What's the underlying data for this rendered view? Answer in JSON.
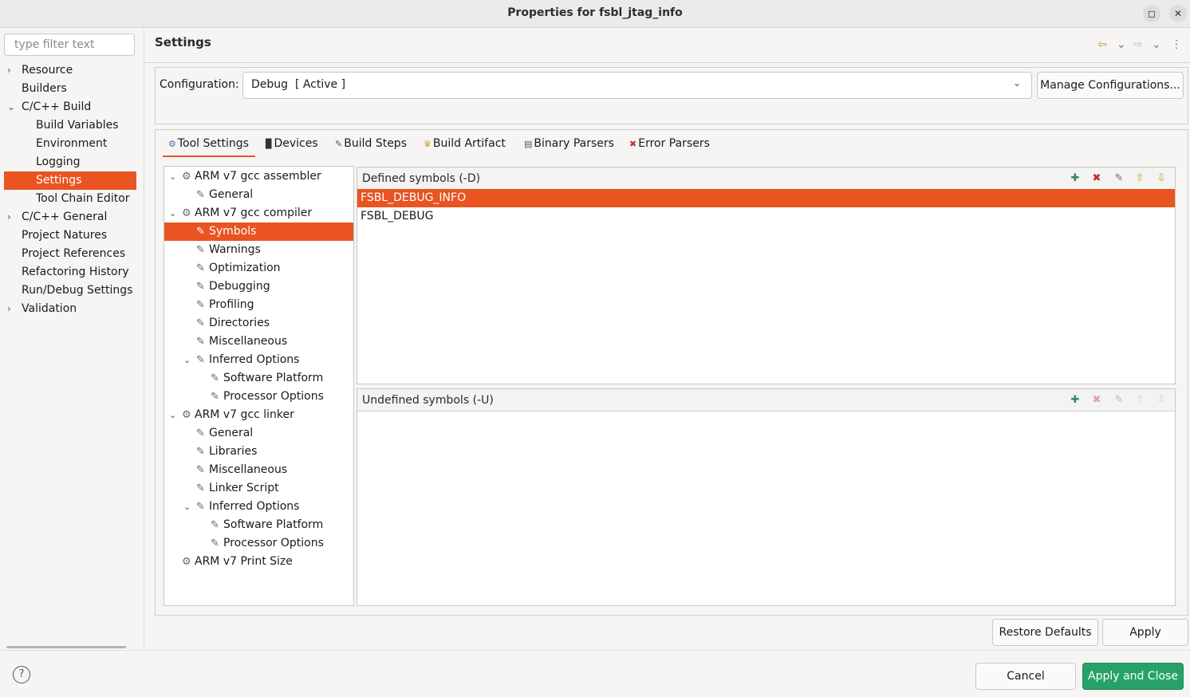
{
  "window": {
    "title": "Properties for fsbl_jtag_info",
    "maximize_glyph": "◻",
    "close_glyph": "✕"
  },
  "filter": {
    "placeholder": "type filter text"
  },
  "nav": {
    "items": [
      {
        "label": "Resource",
        "expander": "›"
      },
      {
        "label": "Builders",
        "expander": ""
      },
      {
        "label": "C/C++ Build",
        "expander": "⌄"
      },
      {
        "label": "Build Variables",
        "expander": ""
      },
      {
        "label": "Environment",
        "expander": ""
      },
      {
        "label": "Logging",
        "expander": ""
      },
      {
        "label": "Settings",
        "expander": ""
      },
      {
        "label": "Tool Chain Editor",
        "expander": ""
      },
      {
        "label": "C/C++ General",
        "expander": "›"
      },
      {
        "label": "Project Natures",
        "expander": ""
      },
      {
        "label": "Project References",
        "expander": ""
      },
      {
        "label": "Refactoring History",
        "expander": ""
      },
      {
        "label": "Run/Debug Settings",
        "expander": ""
      },
      {
        "label": "Validation",
        "expander": "›"
      }
    ],
    "selected": "Settings"
  },
  "header": {
    "title": "Settings",
    "back_icon": "⇦",
    "back_menu_icon": "⌄",
    "forward_icon": "⇨",
    "forward_menu_icon": "⌄",
    "more_icon": "⋮"
  },
  "configuration": {
    "label": "Configuration:",
    "value": "Debug  [ Active ]",
    "chevron": "⌄",
    "manage_label": "Manage Configurations..."
  },
  "tabs": [
    {
      "label": "Tool Settings",
      "icon": "⚙",
      "icon_color": "#4a6fa5",
      "active": true
    },
    {
      "label": "Devices",
      "icon": "▉",
      "icon_color": "#333333"
    },
    {
      "label": "Build Steps",
      "icon": "✎",
      "icon_color": "#555555"
    },
    {
      "label": "Build Artifact",
      "icon": "♛",
      "icon_color": "#d4a017"
    },
    {
      "label": "Binary Parsers",
      "icon": "▤",
      "icon_color": "#555555"
    },
    {
      "label": "Error Parsers",
      "icon": "✖",
      "icon_color": "#d0312d"
    }
  ],
  "tree": {
    "rows": [
      {
        "label": "ARM v7 gcc assembler",
        "expander": "⌄",
        "icon": "⚙"
      },
      {
        "label": "General",
        "expander": "",
        "icon": "✎"
      },
      {
        "label": "ARM v7 gcc compiler",
        "expander": "⌄",
        "icon": "⚙"
      },
      {
        "label": "Symbols",
        "expander": "",
        "icon": "✎"
      },
      {
        "label": "Warnings",
        "expander": "",
        "icon": "✎"
      },
      {
        "label": "Optimization",
        "expander": "",
        "icon": "✎"
      },
      {
        "label": "Debugging",
        "expander": "",
        "icon": "✎"
      },
      {
        "label": "Profiling",
        "expander": "",
        "icon": "✎"
      },
      {
        "label": "Directories",
        "expander": "",
        "icon": "✎"
      },
      {
        "label": "Miscellaneous",
        "expander": "",
        "icon": "✎"
      },
      {
        "label": "Inferred Options",
        "expander": "⌄",
        "icon": "✎"
      },
      {
        "label": "Software Platform",
        "expander": "",
        "icon": "✎"
      },
      {
        "label": "Processor Options",
        "expander": "",
        "icon": "✎"
      },
      {
        "label": "ARM v7 gcc linker",
        "expander": "⌄",
        "icon": "⚙"
      },
      {
        "label": "General",
        "expander": "",
        "icon": "✎"
      },
      {
        "label": "Libraries",
        "expander": "",
        "icon": "✎"
      },
      {
        "label": "Miscellaneous",
        "expander": "",
        "icon": "✎"
      },
      {
        "label": "Linker Script",
        "expander": "",
        "icon": "✎"
      },
      {
        "label": "Inferred Options",
        "expander": "⌄",
        "icon": "✎"
      },
      {
        "label": "Software Platform",
        "expander": "",
        "icon": "✎"
      },
      {
        "label": "Processor Options",
        "expander": "",
        "icon": "✎"
      },
      {
        "label": "ARM v7 Print Size",
        "expander": "",
        "icon": "⚙"
      }
    ],
    "selected_label": "Symbols"
  },
  "defined": {
    "title": "Defined symbols (-D)",
    "items": [
      "FSBL_DEBUG_INFO",
      "FSBL_DEBUG"
    ],
    "toolbar": [
      {
        "name": "add-icon",
        "glyph": "✚",
        "color": "#2e8b57"
      },
      {
        "name": "delete-icon",
        "glyph": "✖",
        "color": "#cc2a2a"
      },
      {
        "name": "edit-icon",
        "glyph": "✎",
        "color": "#8a6d3b"
      },
      {
        "name": "move-up-icon",
        "glyph": "⇧",
        "color": "#c9a227"
      },
      {
        "name": "move-down-icon",
        "glyph": "⇩",
        "color": "#c9a227"
      }
    ]
  },
  "undefined": {
    "title": "Undefined symbols (-U)",
    "items": [],
    "toolbar": [
      {
        "name": "add-icon",
        "glyph": "✚",
        "color": "#2e8b57"
      },
      {
        "name": "delete-icon",
        "glyph": "✖",
        "color": "#e2a3a3"
      },
      {
        "name": "edit-icon",
        "glyph": "✎",
        "color": "#c8b89a"
      },
      {
        "name": "move-up-icon",
        "glyph": "⇧",
        "color": "#e3d193"
      },
      {
        "name": "move-down-icon",
        "glyph": "⇩",
        "color": "#e3d193"
      }
    ]
  },
  "buttons": {
    "restore_defaults": "Restore Defaults",
    "apply": "Apply",
    "cancel": "Cancel",
    "apply_close": "Apply and Close"
  },
  "help_icon": "?",
  "colors": {
    "accent": "#e95420",
    "primary_button": "#26a269"
  }
}
